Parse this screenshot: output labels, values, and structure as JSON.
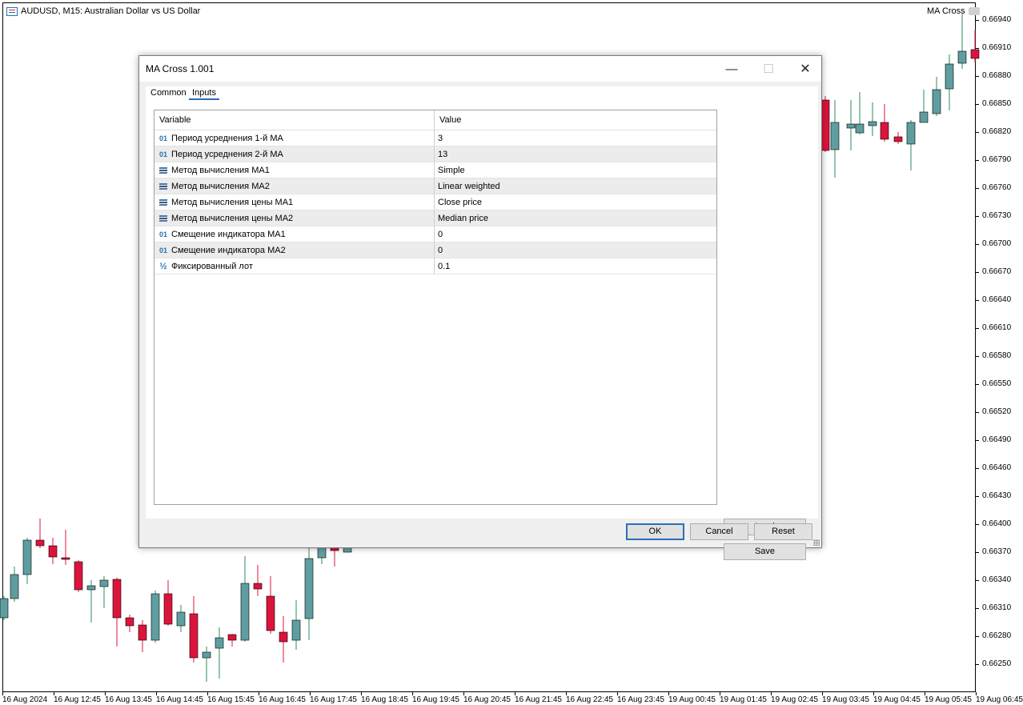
{
  "chart": {
    "symbol_title": "AUDUSD, M15:  Australian Dollar vs US Dollar",
    "ea_name": "MA Cross",
    "price_labels": [
      "0.66940",
      "0.66910",
      "0.66880",
      "0.66850",
      "0.66820",
      "0.66790",
      "0.66760",
      "0.66730",
      "0.66700",
      "0.66670",
      "0.66640",
      "0.66610",
      "0.66580",
      "0.66550",
      "0.66520",
      "0.66490",
      "0.66460",
      "0.66430",
      "0.66400",
      "0.66370",
      "0.66340",
      "0.66310",
      "0.66280",
      "0.66250"
    ],
    "time_labels": [
      "16 Aug 2024",
      "16 Aug 12:45",
      "16 Aug 13:45",
      "16 Aug 14:45",
      "16 Aug 15:45",
      "16 Aug 16:45",
      "16 Aug 17:45",
      "16 Aug 18:45",
      "16 Aug 19:45",
      "16 Aug 20:45",
      "16 Aug 21:45",
      "16 Aug 22:45",
      "16 Aug 23:45",
      "19 Aug 00:45",
      "19 Aug 01:45",
      "19 Aug 02:45",
      "19 Aug 03:45",
      "19 Aug 04:45",
      "19 Aug 05:45",
      "19 Aug 06:45"
    ],
    "colors": {
      "bull": "#5f9ea0",
      "bear": "#dc143c",
      "wick_bull": "#2e8b57",
      "wick_bear": "#dc143c"
    }
  },
  "dialog": {
    "title": "MA Cross 1.001",
    "tabs": [
      "Common",
      "Inputs"
    ],
    "active_tab": "Inputs",
    "columns": {
      "variable": "Variable",
      "value": "Value"
    },
    "params": [
      {
        "type": "int",
        "icon_text": "01",
        "name": "Период усреднения 1-й МА",
        "value": "3"
      },
      {
        "type": "int",
        "icon_text": "01",
        "name": "Период усреднения 2-й МА",
        "value": "13"
      },
      {
        "type": "enum",
        "icon_text": "",
        "name": "Метод вычисления МА1",
        "value": "Simple"
      },
      {
        "type": "enum",
        "icon_text": "",
        "name": "Метод вычисления МА2",
        "value": "Linear weighted"
      },
      {
        "type": "enum",
        "icon_text": "",
        "name": "Метод вычисления цены МА1",
        "value": "Close price"
      },
      {
        "type": "enum",
        "icon_text": "",
        "name": "Метод вычисления цены МА2",
        "value": "Median price"
      },
      {
        "type": "int",
        "icon_text": "01",
        "name": "Смещение индикатора МА1",
        "value": "0"
      },
      {
        "type": "int",
        "icon_text": "01",
        "name": "Смещение индикатора МА2",
        "value": "0"
      },
      {
        "type": "double",
        "icon_text": "½",
        "name": "Фиксированный лот",
        "value": "0.1"
      }
    ],
    "buttons": {
      "load": "Load",
      "save": "Save",
      "ok": "OK",
      "cancel": "Cancel",
      "reset": "Reset"
    },
    "window_controls": {
      "minimize": "—",
      "maximize": "☐",
      "close": "✕"
    }
  }
}
